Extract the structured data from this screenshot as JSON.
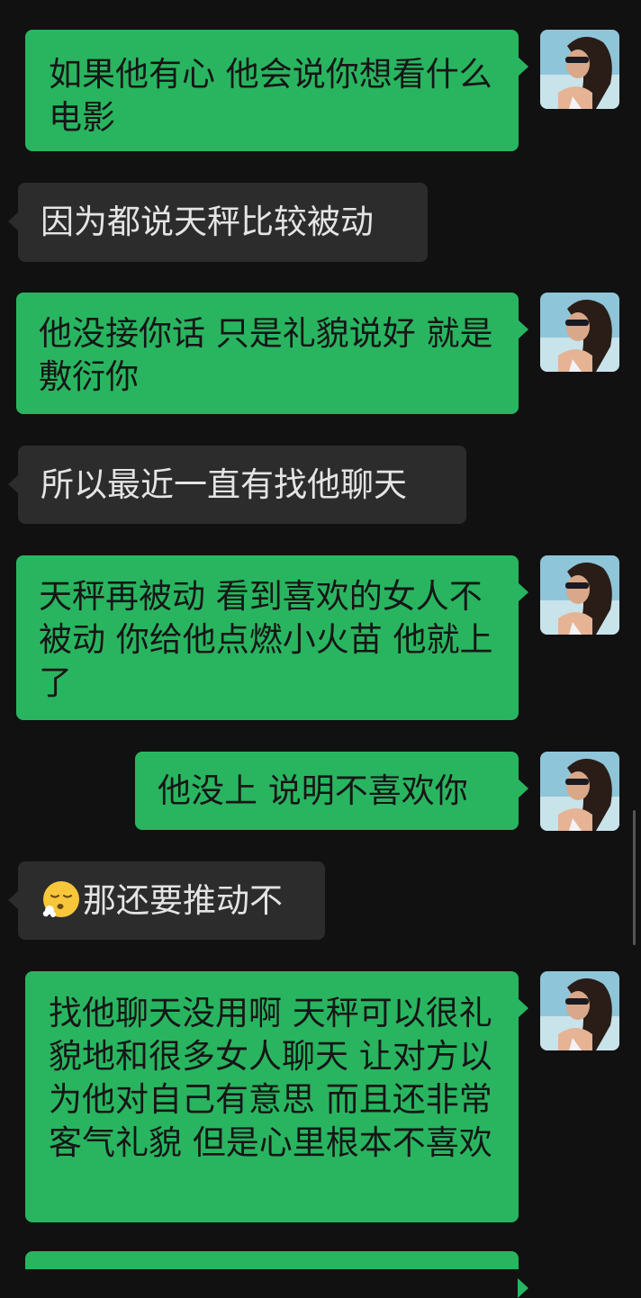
{
  "colors": {
    "background": "#111111",
    "outgoing_bubble": "#29b560",
    "incoming_bubble": "#2c2c2c",
    "outgoing_text": "#161616",
    "incoming_text": "#e4e4e4"
  },
  "messages": [
    {
      "side": "outgoing",
      "text": "如果他有心 他会说你想看什么电影"
    },
    {
      "side": "incoming",
      "text": "因为都说天秤比较被动"
    },
    {
      "side": "outgoing",
      "text": "他没接你话 只是礼貌说好 就是敷衍你"
    },
    {
      "side": "incoming",
      "text": "所以最近一直有找他聊天"
    },
    {
      "side": "outgoing",
      "text": "天秤再被动 看到喜欢的女人不被动 你给他点燃小火苗 他就上了"
    },
    {
      "side": "outgoing",
      "text": "他没上 说明不喜欢你"
    },
    {
      "side": "incoming",
      "emoji": "sighing-face-emoji",
      "text": "那还要推动不"
    },
    {
      "side": "outgoing",
      "text": "找他聊天没用啊 天秤可以很礼貌地和很多女人聊天 让对方以为他对自己有意思 而且还非常客气礼貌 但是心里根本不喜欢"
    }
  ],
  "avatar": {
    "icon": "user-avatar-photo"
  }
}
